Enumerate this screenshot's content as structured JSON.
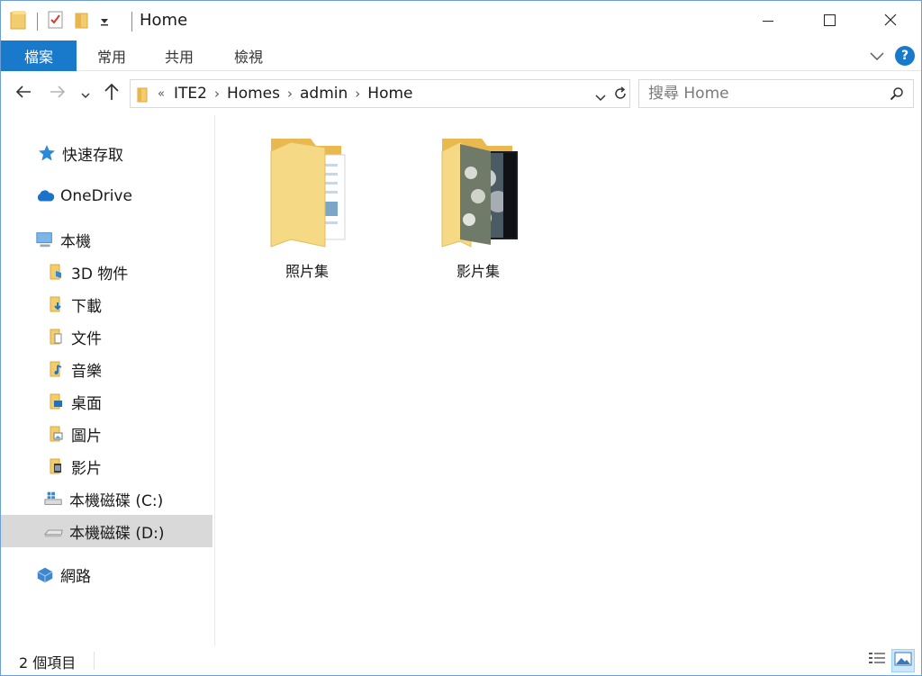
{
  "window": {
    "title": "Home",
    "accent_color": "#1979ca"
  },
  "ribbon": {
    "tabs": [
      {
        "label": "檔案"
      },
      {
        "label": "常用"
      },
      {
        "label": "共用"
      },
      {
        "label": "檢視"
      }
    ],
    "help_label": "?"
  },
  "address": {
    "overflow": "«",
    "crumbs": [
      "ITE2",
      "Homes",
      "admin",
      "Home"
    ]
  },
  "search": {
    "placeholder": "搜尋 Home"
  },
  "sidebar": {
    "items": [
      {
        "label": "快速存取",
        "icon": "star-icon"
      },
      {
        "label": "OneDrive",
        "icon": "cloud-icon"
      },
      {
        "label": "本機",
        "icon": "computer-icon"
      },
      {
        "label": "3D 物件",
        "icon": "3d-objects-folder-icon"
      },
      {
        "label": "下載",
        "icon": "downloads-folder-icon"
      },
      {
        "label": "文件",
        "icon": "documents-folder-icon"
      },
      {
        "label": "音樂",
        "icon": "music-folder-icon"
      },
      {
        "label": "桌面",
        "icon": "desktop-folder-icon"
      },
      {
        "label": "圖片",
        "icon": "pictures-folder-icon"
      },
      {
        "label": "影片",
        "icon": "videos-folder-icon"
      },
      {
        "label": "本機磁碟 (C:)",
        "icon": "windows-drive-icon"
      },
      {
        "label": "本機磁碟 (D:)",
        "icon": "drive-icon",
        "selected": true
      },
      {
        "label": "網路",
        "icon": "network-icon"
      }
    ]
  },
  "content": {
    "items": [
      {
        "label": "照片集",
        "icon": "photos-folder-icon"
      },
      {
        "label": "影片集",
        "icon": "video-folder-icon"
      }
    ]
  },
  "status": {
    "item_count": "2 個項目"
  }
}
